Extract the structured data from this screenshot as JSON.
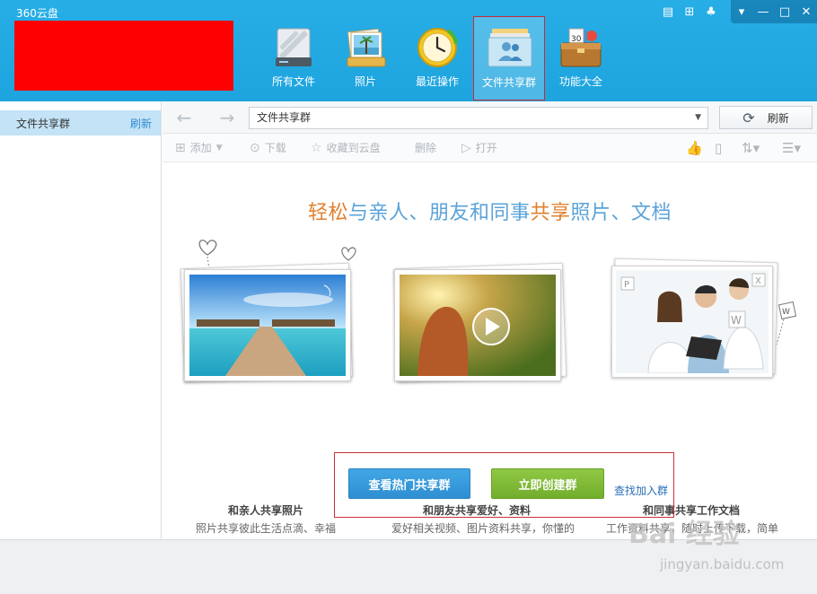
{
  "window": {
    "title": "360云盘"
  },
  "nav": {
    "items": [
      {
        "label": "所有文件",
        "icon": "drive-icon"
      },
      {
        "label": "照片",
        "icon": "photo-icon"
      },
      {
        "label": "最近操作",
        "icon": "clock-icon"
      },
      {
        "label": "文件共享群",
        "icon": "share-group-icon",
        "active": true
      },
      {
        "label": "功能大全",
        "icon": "toolbox-icon"
      }
    ]
  },
  "sidebar": {
    "item_label": "文件共享群",
    "refresh_link": "刷新"
  },
  "address": {
    "value": "文件共享群",
    "refresh_label": "刷新"
  },
  "toolbar": {
    "add": "添加",
    "download": "下载",
    "collect": "收藏到云盘",
    "delete": "删除",
    "open": "打开"
  },
  "main": {
    "headline": {
      "part1": "轻松",
      "part2": "与亲人、朋友和同事",
      "part3": "共享",
      "part4": "照片、文档"
    },
    "cards": [
      {
        "title": "和亲人共享照片",
        "subtitle": "照片共享彼此生活点滴、幸福"
      },
      {
        "title": "和朋友共享爱好、资料",
        "subtitle": "爱好相关视频、图片资料共享，你懂的"
      },
      {
        "title": "和同事共享工作文档",
        "subtitle": "工作资料共享，随时上传下载，简单"
      }
    ],
    "btn_hot": "查看热门共享群",
    "btn_create": "立即创建群",
    "link_join": "查找加入群"
  },
  "watermark": {
    "brand": "Bai 经验",
    "url": "jingyan.baidu.com"
  },
  "colors": {
    "topbar": "#1ea4de",
    "accent_orange": "#e0812f",
    "accent_blue": "#5ba3d8",
    "highlight_red": "#c9303d"
  }
}
